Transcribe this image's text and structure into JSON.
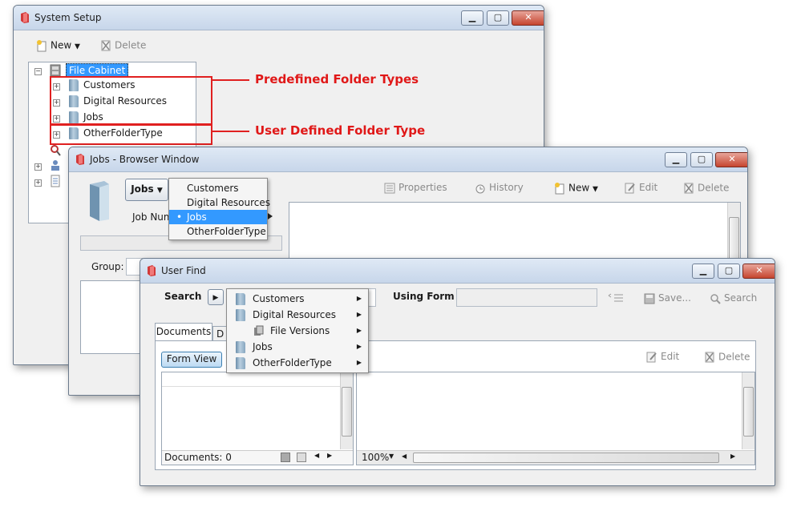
{
  "system_setup": {
    "title": "System Setup",
    "toolbar": {
      "new_label": "New",
      "delete_label": "Delete"
    },
    "tree": {
      "root": "File Cabinet",
      "items": [
        "Customers",
        "Digital Resources",
        "Jobs",
        "OtherFolderType"
      ]
    }
  },
  "annotations": {
    "predefined": "Predefined Folder Types",
    "user_defined": "User Defined Folder Type"
  },
  "browser": {
    "title": "Jobs - Browser Window",
    "folder_type_button": "Jobs",
    "job_number_label": "Job Num",
    "group_label": "Group:",
    "toolbar": {
      "properties": "Properties",
      "history": "History",
      "new": "New",
      "edit": "Edit",
      "delete": "Delete"
    },
    "dropdown": {
      "options": [
        "Customers",
        "Digital Resources",
        "Jobs",
        "OtherFolderType"
      ],
      "selected": "Jobs"
    }
  },
  "user_find": {
    "title": "User Find",
    "search_label": "Search",
    "using_form_label": "Using Form",
    "save_label": "Save...",
    "search_button": "Search",
    "tabs": [
      "Documents",
      "D"
    ],
    "form_view_button": "Form View",
    "edit_label": "Edit",
    "delete_label": "Delete",
    "documents_count": "Documents: 0",
    "zoom": "100%",
    "search_menu": [
      "Customers",
      "Digital Resources",
      "File Versions",
      "Jobs",
      "OtherFolderType"
    ]
  },
  "colors": {
    "annotation": "#e01818",
    "selection": "#3399ff"
  }
}
